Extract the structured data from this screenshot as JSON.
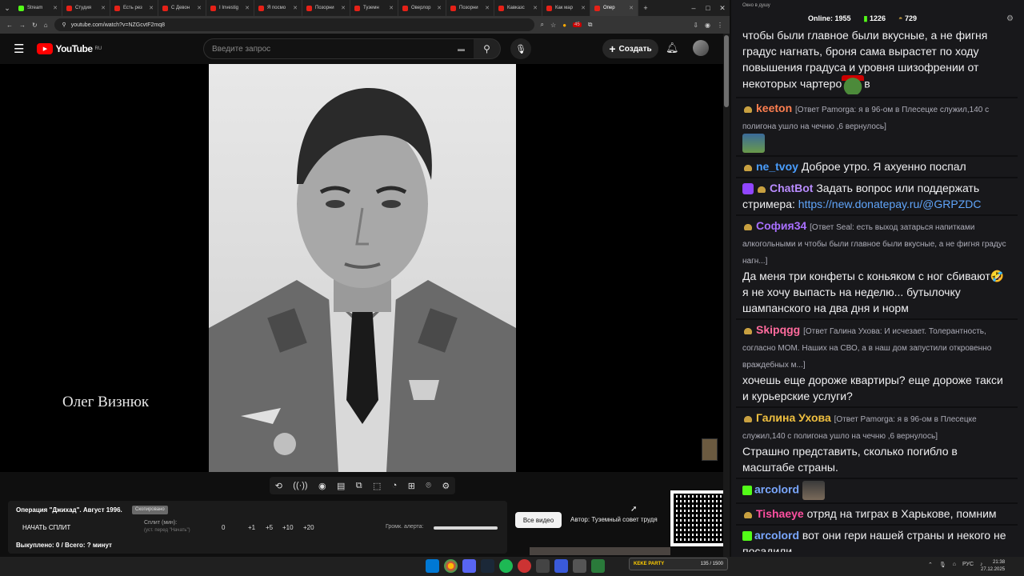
{
  "browser": {
    "tabs": [
      {
        "label": "Stream",
        "icon": "kick-favicon"
      },
      {
        "label": "Студия",
        "icon": "youtube-favicon"
      },
      {
        "label": "Есть рез",
        "icon": "youtube-favicon"
      },
      {
        "label": "С Девон",
        "icon": "youtube-favicon"
      },
      {
        "label": "I Investig",
        "icon": "youtube-favicon"
      },
      {
        "label": "Я посмо",
        "icon": "youtube-favicon"
      },
      {
        "label": "Позорни",
        "icon": "youtube-favicon"
      },
      {
        "label": "Туземн",
        "icon": "youtube-favicon"
      },
      {
        "label": "Оверлор",
        "icon": "youtube-favicon"
      },
      {
        "label": "Позорни",
        "icon": "youtube-favicon"
      },
      {
        "label": "Кавказс",
        "icon": "youtube-favicon"
      },
      {
        "label": "Как мар",
        "icon": "youtube-favicon"
      },
      {
        "label": "Опер",
        "icon": "youtube-favicon",
        "active": true
      }
    ],
    "new_tab": "+",
    "url": "youtube.com/watch?v=NZGcvtF2mq8",
    "ext_badge": "45"
  },
  "youtube": {
    "logo_text": "YouTube",
    "logo_region": "RU",
    "search_placeholder": "Введите запрос",
    "create_label": "Создать"
  },
  "video": {
    "caption": "Олег Визнюк"
  },
  "panel": {
    "title": "Операция \"Джихад\". Август 1996.",
    "copy_badge": "Скопировано",
    "start_split": "НАЧАТЬ СПЛИТ",
    "split_label": "Сплит (мин):",
    "split_hint": "(уст. перед \"Начать\")",
    "split_value": "0",
    "increments": [
      "+1",
      "+5",
      "+10",
      "+20"
    ],
    "alert_label": "Громк. алерта:",
    "alert_level": 1.0,
    "bought": "Выкуплено: 0 / Всего: ? минут",
    "all_video": "Все видео",
    "author": "Автор: Туземный совет трудя"
  },
  "chat": {
    "window_title": "Окно в душу",
    "online_label": "Online:",
    "online": "1955",
    "kick_count": "1226",
    "bowl_count": "729",
    "messages": [
      {
        "nick": "",
        "text": "чтобы были главное были вкусные, а не фигня градус нагнать, броня сама вырастет по ходу повышения градуса и уровня шизофрении от некоторых чартеро",
        "tail": "в"
      },
      {
        "nick": "keeton",
        "color": "#ff7f50",
        "reply": "[Ответ Pamorga: я в 96-ом в Плесецке служил,140 с полигона ушло на чечню ,6 вернулось]",
        "text": ""
      },
      {
        "nick": "ne_tvoy",
        "color": "#4a9eff",
        "text": "Доброе утро. Я ахуенно поспал"
      },
      {
        "nick": "ChatBot",
        "color": "#b98cff",
        "text": "Задать вопрос или поддержать стримера: ",
        "link": "https://new.donatepay.ru/@GRPZDC"
      },
      {
        "nick": "София34",
        "color": "#a970ff",
        "reply": "[Ответ Seal: есть выход затарься напитками алкогольными и чтобы были главное были вкусные, а не фигня градус нагн...]",
        "text": "Да меня три конфеты с коньяком с ног сбивают🤣 я не хочу выпасть на неделю... бутылочку шампанского на два дня и норм"
      },
      {
        "nick": "Skipqgg",
        "color": "#ff6b9d",
        "reply": "[Ответ Галина Ухова: И исчезает. Толерантность, согласно МОМ. Наших на СВО, а в наш дом запустили откровенно враждебных м...]",
        "text": "хочешь еще дороже квартиры? еще дороже такси и курьерские услуги?"
      },
      {
        "nick": "Галина Ухова",
        "color": "#f0c040",
        "reply": "[Ответ Pamorga: я в 96-ом в Плесецке служил,140 с полигона ушло на чечню ,6 вернулось]",
        "text": "Страшно представить, сколько погибло в масштабе страны."
      },
      {
        "nick": "arcolord",
        "color": "#7aa7ff",
        "text": ""
      },
      {
        "nick": "Tishaeye",
        "color": "#ff4fa0",
        "text": "отряд на тиграх в Харькове, помним"
      },
      {
        "nick": "arcolord",
        "color": "#7aa7ff",
        "text": "вот они гери нашей страны и некого не посадили"
      }
    ]
  },
  "taskbar": {
    "kek_title": "KEKE PARTY",
    "kek_progress": "135 / 1500",
    "lang": "РУС",
    "time": "21:38",
    "date": "27.12.2025"
  }
}
